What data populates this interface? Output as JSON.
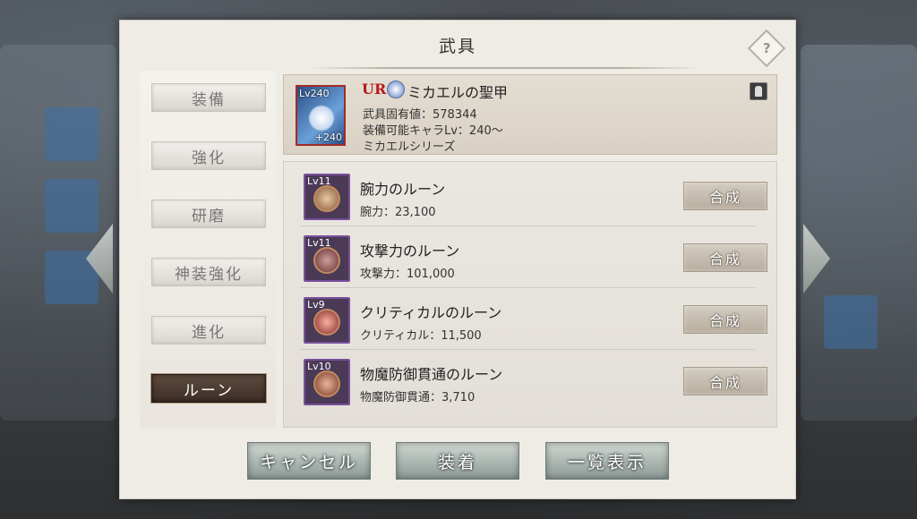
{
  "dialog": {
    "title": "武具",
    "help_glyph": "?"
  },
  "side_menu": {
    "items": [
      {
        "label": "装備",
        "active": false
      },
      {
        "label": "強化",
        "active": false
      },
      {
        "label": "研磨",
        "active": false
      },
      {
        "label": "神装強化",
        "active": false
      },
      {
        "label": "進化",
        "active": false
      },
      {
        "label": "ルーン",
        "active": true
      }
    ]
  },
  "item": {
    "level": "Lv240",
    "plus": "+240",
    "rarity": "UR",
    "name": "ミカエルの聖甲",
    "unique_value": "武具固有値：578344",
    "equip_level": "装備可能キャラLv：240～",
    "series": "ミカエルシリーズ"
  },
  "runes": [
    {
      "level": "Lv11",
      "name": "腕力のルーン",
      "stat": "腕力：23,100",
      "button": "合成"
    },
    {
      "level": "Lv11",
      "name": "攻撃力のルーン",
      "stat": "攻撃力：101,000",
      "button": "合成"
    },
    {
      "level": "Lv9",
      "name": "クリティカルのルーン",
      "stat": "クリティカル：11,500",
      "button": "合成"
    },
    {
      "level": "Lv10",
      "name": "物魔防御貫通のルーン",
      "stat": "物魔防御貫通：3,710",
      "button": "合成"
    }
  ],
  "buttons": {
    "cancel": "キャンセル",
    "equip": "装着",
    "list_view": "一覧表示"
  },
  "colors": {
    "rarity": "#b8181c",
    "active_tab": "#3e2f28",
    "rune_frame": "#7a4f9c"
  }
}
